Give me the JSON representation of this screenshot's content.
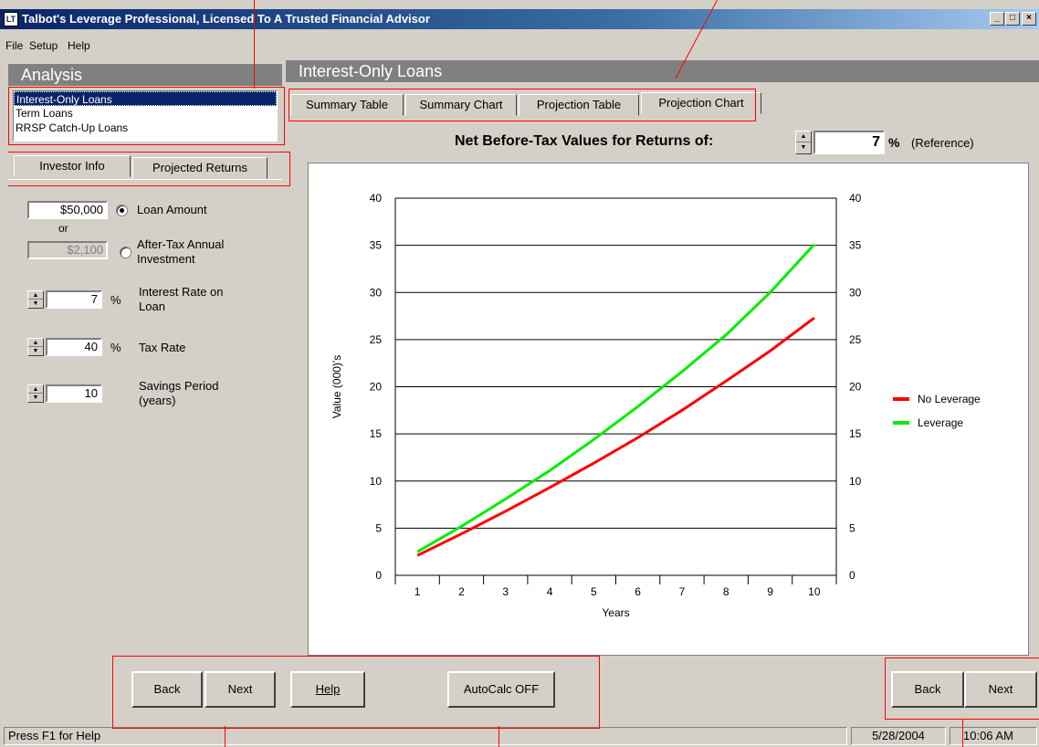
{
  "window": {
    "icon_text": "LT",
    "title": "Talbot's Leverage Professional, Licensed To A Trusted Financial Advisor",
    "minimize": "_",
    "maximize": "□",
    "close": "×"
  },
  "menu": {
    "items": [
      "File",
      "Setup",
      "Help"
    ]
  },
  "left": {
    "header": "Analysis",
    "analysis_list": [
      "Interest-Only Loans",
      "Term Loans",
      "RRSP Catch-Up Loans"
    ],
    "selected_index": 0,
    "tabs": [
      "Investor Info",
      "Projected Returns"
    ],
    "loan_amount_value": "$50,000",
    "loan_amount_label": "Loan Amount",
    "or_text": "or",
    "after_tax_value": "$2,100",
    "after_tax_label_1": "After-Tax Annual",
    "after_tax_label_2": "Investment",
    "interest_rate_value": "7",
    "interest_rate_unit": "%",
    "interest_rate_label_1": "Interest Rate on",
    "interest_rate_label_2": "Loan",
    "tax_rate_value": "40",
    "tax_rate_unit": "%",
    "tax_rate_label": "Tax Rate",
    "savings_value": "10",
    "savings_label_1": "Savings Period",
    "savings_label_2": "(years)",
    "back_label": "Back",
    "next_label": "Next"
  },
  "main": {
    "header": "Interest-Only Loans",
    "tabs": [
      "Summary Table",
      "Summary Chart",
      "Projection Table",
      "Projection Chart"
    ],
    "active_tab": 3,
    "returns_label": "Net Before-Tax Values for Returns of:",
    "returns_value": "7",
    "returns_unit": "%",
    "returns_note": "(Reference)",
    "help_label": "Help",
    "autocalc_label": "AutoCalc OFF",
    "back_label": "Back",
    "next_label": "Next"
  },
  "status": {
    "help_text": "Press F1 for Help",
    "date": "5/28/2004",
    "time": "10:06 AM"
  },
  "colors": {
    "no_leverage": "#ff0000",
    "leverage": "#00ee00",
    "selection": "#0a246a",
    "annotation": "#ff0000"
  },
  "chart_data": {
    "type": "line",
    "xlabel": "Years",
    "ylabel": "Value (000)'s",
    "x": [
      1,
      2,
      3,
      4,
      5,
      6,
      7,
      8,
      9,
      10
    ],
    "ylim": [
      0,
      40
    ],
    "yticks": [
      0,
      5,
      10,
      15,
      20,
      25,
      30,
      35,
      40
    ],
    "grid": true,
    "legend_position": "right",
    "series": [
      {
        "name": "No Leverage",
        "values": [
          2.1,
          4.4,
          6.8,
          9.3,
          11.9,
          14.6,
          17.5,
          20.6,
          23.8,
          27.3
        ]
      },
      {
        "name": "Leverage",
        "values": [
          2.5,
          5.2,
          8.1,
          11.1,
          14.4,
          17.9,
          21.6,
          25.5,
          30.0,
          35.1
        ]
      }
    ]
  }
}
